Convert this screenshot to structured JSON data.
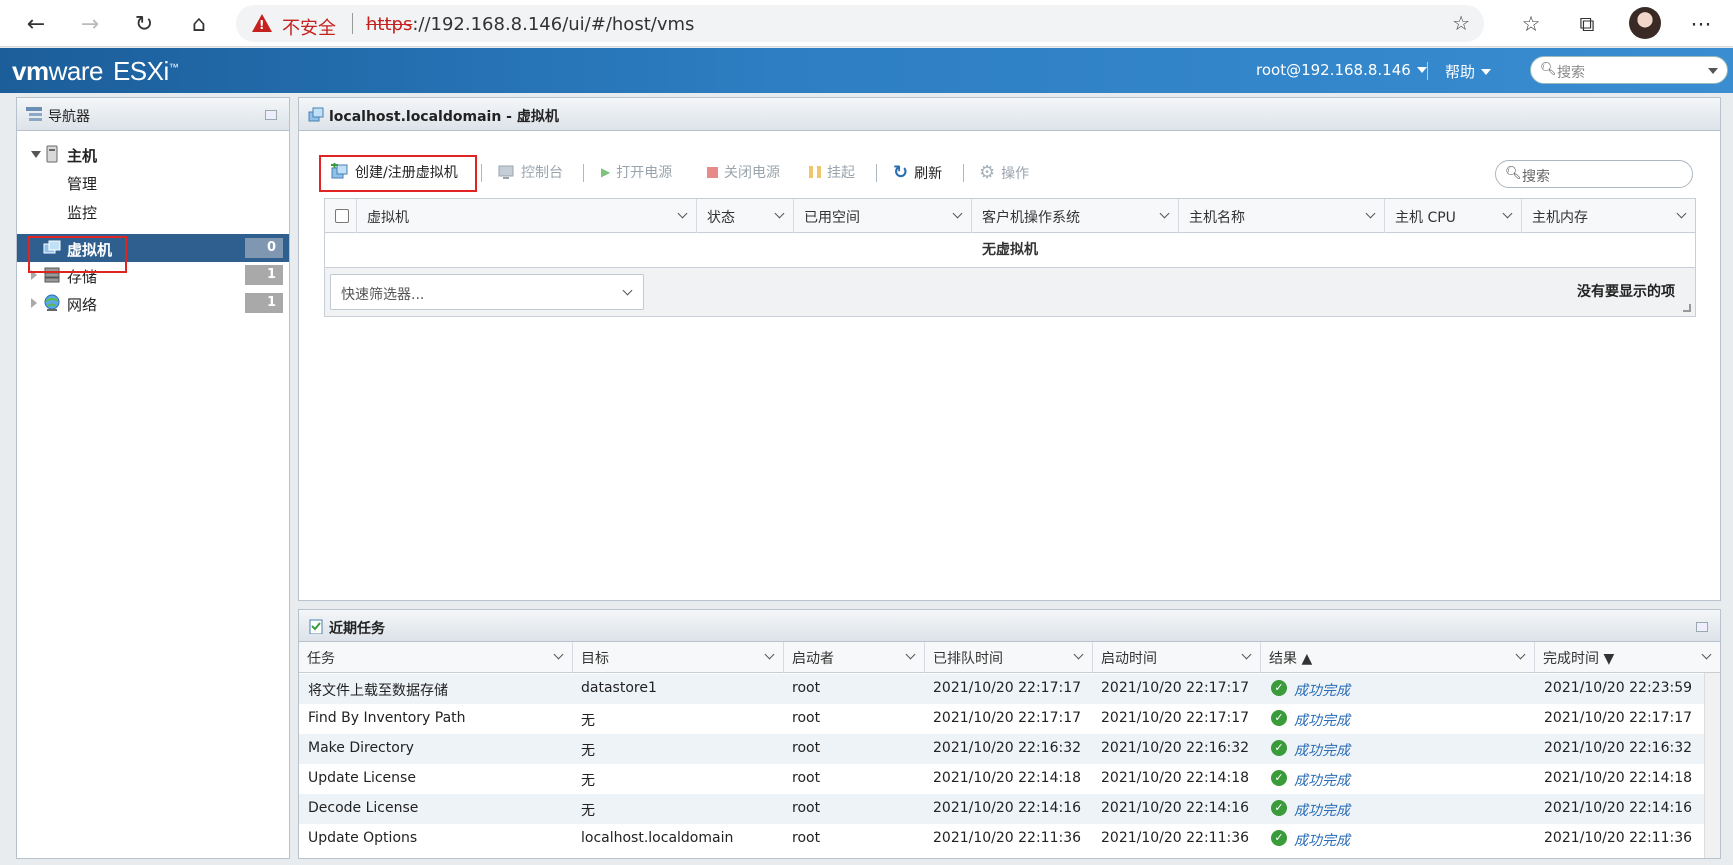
{
  "browser": {
    "warning": "不安全",
    "url_proto": "https",
    "url_rest": "://192.168.8.146/ui/#/host/vms"
  },
  "header": {
    "logo_vm": "vm",
    "logo_ware": "ware",
    "logo_product": "ESXi",
    "user": "root@192.168.8.146",
    "help": "帮助",
    "search_placeholder": "搜索"
  },
  "navigator": {
    "title": "导航器",
    "host_label": "主机",
    "manage": "管理",
    "monitor": "监控",
    "vms_label": "虚拟机",
    "vms_count": "0",
    "storage_label": "存储",
    "storage_count": "1",
    "network_label": "网络",
    "network_count": "1"
  },
  "main": {
    "title": "localhost.localdomain - 虚拟机",
    "toolbar": {
      "create": "创建/注册虚拟机",
      "console": "控制台",
      "power_on": "打开电源",
      "power_off": "关闭电源",
      "suspend": "挂起",
      "refresh": "刷新",
      "actions": "操作",
      "search_placeholder": "搜索"
    },
    "columns": [
      "虚拟机",
      "状态",
      "已用空间",
      "客户机操作系统",
      "主机名称",
      "主机 CPU",
      "主机内存"
    ],
    "empty_text": "无虚拟机",
    "quick_filter": "快速筛选器...",
    "no_items": "没有要显示的项"
  },
  "tasks": {
    "title": "近期任务",
    "columns": [
      "任务",
      "目标",
      "启动者",
      "已排队时间",
      "启动时间",
      "结果 ▲",
      "完成时间 ▼"
    ],
    "rows": [
      {
        "task": "将文件上载至数据存储",
        "target": "datastore1",
        "initiator": "root",
        "queued": "2021/10/20 22:17:17",
        "started": "2021/10/20 22:17:17",
        "result": "成功完成",
        "completed": "2021/10/20 22:23:59"
      },
      {
        "task": "Find By Inventory Path",
        "target": "无",
        "initiator": "root",
        "queued": "2021/10/20 22:17:17",
        "started": "2021/10/20 22:17:17",
        "result": "成功完成",
        "completed": "2021/10/20 22:17:17"
      },
      {
        "task": "Make Directory",
        "target": "无",
        "initiator": "root",
        "queued": "2021/10/20 22:16:32",
        "started": "2021/10/20 22:16:32",
        "result": "成功完成",
        "completed": "2021/10/20 22:16:32"
      },
      {
        "task": "Update License",
        "target": "无",
        "initiator": "root",
        "queued": "2021/10/20 22:14:18",
        "started": "2021/10/20 22:14:18",
        "result": "成功完成",
        "completed": "2021/10/20 22:14:18"
      },
      {
        "task": "Decode License",
        "target": "无",
        "initiator": "root",
        "queued": "2021/10/20 22:14:16",
        "started": "2021/10/20 22:14:16",
        "result": "成功完成",
        "completed": "2021/10/20 22:14:16"
      },
      {
        "task": "Update Options",
        "target": "localhost.localdomain",
        "initiator": "root",
        "queued": "2021/10/20 22:11:36",
        "started": "2021/10/20 22:11:36",
        "result": "成功完成",
        "completed": "2021/10/20 22:11:36"
      }
    ]
  },
  "colors": {
    "header_blue": "#2d7ec3",
    "selected_nav": "#2e5f8f",
    "highlight_red": "#e02424",
    "success_green": "#3a9b3a",
    "success_text": "#2a6cb5"
  }
}
